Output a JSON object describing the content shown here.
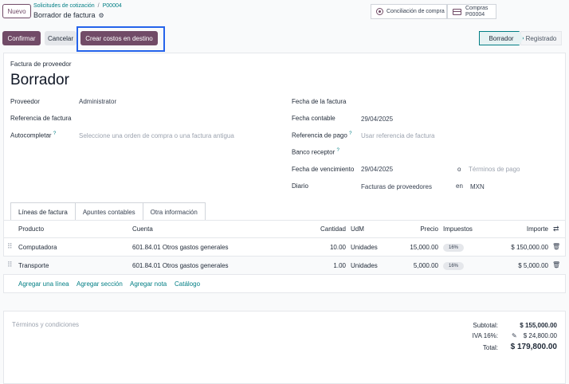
{
  "header": {
    "new_label": "Nuevo",
    "breadcrumb_parent": "Solicitudes de cotización",
    "breadcrumb_sep": "/",
    "breadcrumb_child": "P00004",
    "record_title": "Borrador de factura"
  },
  "smart_buttons": {
    "reconcile_label": "Conciliación de compra",
    "purchase_label": "Compras",
    "purchase_ref": "P00004"
  },
  "actions": {
    "confirm": "Confirmar",
    "cancel": "Cancelar",
    "create_costs": "Crear costos en destino"
  },
  "status": {
    "draft": "Borrador",
    "posted": "Registrado"
  },
  "form": {
    "doc_type": "Factura de proveedor",
    "doc_name": "Borrador",
    "left": {
      "vendor_label": "Proveedor",
      "vendor_value": "Administrator",
      "ref_label": "Referencia de factura",
      "autocomplete_label": "Autocompletar",
      "autocomplete_placeholder": "Seleccione una orden de compra o una factura antigua"
    },
    "right": {
      "invoice_date_label": "Fecha de la factura",
      "acc_date_label": "Fecha contable",
      "acc_date_value": "29/04/2025",
      "pay_ref_label": "Referencia de pago",
      "pay_ref_placeholder": "Usar referencia de factura",
      "bank_label": "Banco receptor",
      "due_label": "Fecha de vencimiento",
      "due_value": "29/04/2025",
      "due_or": "o",
      "terms_placeholder": "Términos de pago",
      "journal_label": "Diario",
      "journal_value": "Facturas de proveedores",
      "journal_in": "en",
      "currency": "MXN"
    }
  },
  "tabs": [
    "Líneas de factura",
    "Apuntes contables",
    "Otra información"
  ],
  "table": {
    "headers": {
      "product": "Producto",
      "account": "Cuenta",
      "qty": "Cantidad",
      "uom": "UdM",
      "price": "Precio",
      "taxes": "Impuestos",
      "amount": "Importe"
    },
    "rows": [
      {
        "product": "Computadora",
        "account": "601.84.01 Otros gastos generales",
        "qty": "10.00",
        "uom": "Unidades",
        "price": "15,000.00",
        "tax": "16%",
        "amount": "$ 150,000.00"
      },
      {
        "product": "Transporte",
        "account": "601.84.01 Otros gastos generales",
        "qty": "1.00",
        "uom": "Unidades",
        "price": "5,000.00",
        "tax": "16%",
        "amount": "$ 5,000.00"
      }
    ],
    "links": [
      "Agregar una línea",
      "Agregar sección",
      "Agregar nota",
      "Catálogo"
    ]
  },
  "terms_placeholder": "Términos y condiciones",
  "totals": {
    "subtotal_label": "Subtotal:",
    "subtotal_value": "$ 155,000.00",
    "tax_label": "IVA 16%:",
    "tax_value": "$ 24,800.00",
    "total_label": "Total:",
    "total_value": "$ 179,800.00"
  },
  "colors": {
    "brand": "#714b67",
    "link": "#017e84",
    "highlight": "#2563eb"
  }
}
